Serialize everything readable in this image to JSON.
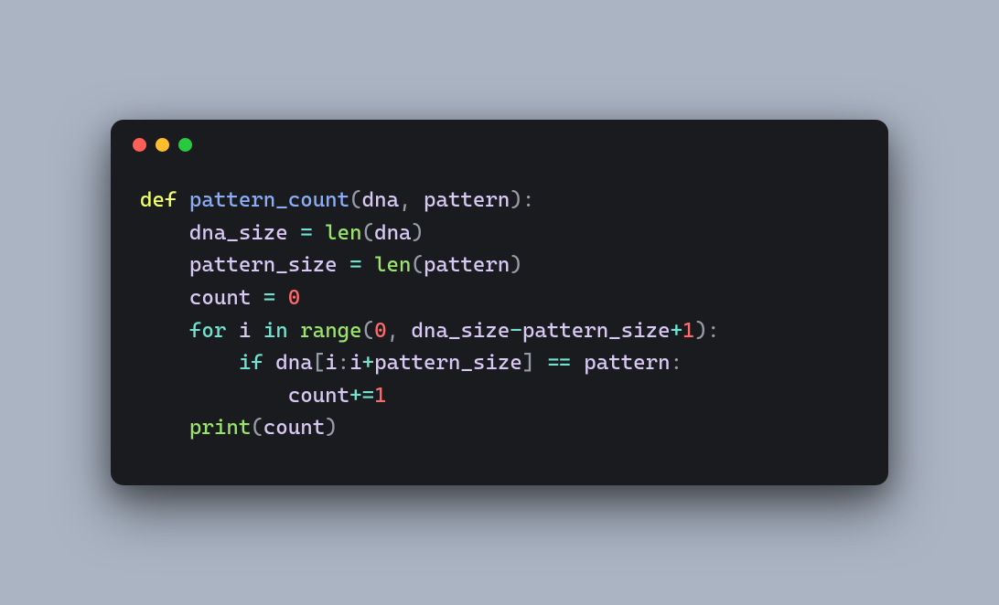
{
  "code": {
    "tokens": [
      [
        {
          "t": "def",
          "c": "kw-def"
        },
        {
          "t": " ",
          "c": ""
        },
        {
          "t": "pattern_count",
          "c": "fn-name"
        },
        {
          "t": "(",
          "c": "punct"
        },
        {
          "t": "dna",
          "c": "var"
        },
        {
          "t": ", ",
          "c": "punct"
        },
        {
          "t": "pattern",
          "c": "var"
        },
        {
          "t": "):",
          "c": "punct"
        }
      ],
      [
        {
          "t": "    ",
          "c": ""
        },
        {
          "t": "dna_size",
          "c": "var"
        },
        {
          "t": " ",
          "c": ""
        },
        {
          "t": "=",
          "c": "op"
        },
        {
          "t": " ",
          "c": ""
        },
        {
          "t": "len",
          "c": "builtin"
        },
        {
          "t": "(",
          "c": "punct"
        },
        {
          "t": "dna",
          "c": "var"
        },
        {
          "t": ")",
          "c": "punct"
        }
      ],
      [
        {
          "t": "    ",
          "c": ""
        },
        {
          "t": "pattern_size",
          "c": "var"
        },
        {
          "t": " ",
          "c": ""
        },
        {
          "t": "=",
          "c": "op"
        },
        {
          "t": " ",
          "c": ""
        },
        {
          "t": "len",
          "c": "builtin"
        },
        {
          "t": "(",
          "c": "punct"
        },
        {
          "t": "pattern",
          "c": "var"
        },
        {
          "t": ")",
          "c": "punct"
        }
      ],
      [
        {
          "t": "    ",
          "c": ""
        },
        {
          "t": "count",
          "c": "var"
        },
        {
          "t": " ",
          "c": ""
        },
        {
          "t": "=",
          "c": "op"
        },
        {
          "t": " ",
          "c": ""
        },
        {
          "t": "0",
          "c": "num"
        }
      ],
      [
        {
          "t": "    ",
          "c": ""
        },
        {
          "t": "for",
          "c": "kw-flow"
        },
        {
          "t": " ",
          "c": ""
        },
        {
          "t": "i",
          "c": "var"
        },
        {
          "t": " ",
          "c": ""
        },
        {
          "t": "in",
          "c": "kw-flow"
        },
        {
          "t": " ",
          "c": ""
        },
        {
          "t": "range",
          "c": "builtin"
        },
        {
          "t": "(",
          "c": "punct"
        },
        {
          "t": "0",
          "c": "num"
        },
        {
          "t": ", ",
          "c": "punct"
        },
        {
          "t": "dna_size",
          "c": "var"
        },
        {
          "t": "-",
          "c": "op"
        },
        {
          "t": "pattern_size",
          "c": "var"
        },
        {
          "t": "+",
          "c": "op"
        },
        {
          "t": "1",
          "c": "num"
        },
        {
          "t": "):",
          "c": "punct"
        }
      ],
      [
        {
          "t": "        ",
          "c": ""
        },
        {
          "t": "if",
          "c": "kw-flow"
        },
        {
          "t": " ",
          "c": ""
        },
        {
          "t": "dna",
          "c": "var"
        },
        {
          "t": "[",
          "c": "punct"
        },
        {
          "t": "i",
          "c": "var"
        },
        {
          "t": ":",
          "c": "punct"
        },
        {
          "t": "i",
          "c": "var"
        },
        {
          "t": "+",
          "c": "op"
        },
        {
          "t": "pattern_size",
          "c": "var"
        },
        {
          "t": "]",
          "c": "punct"
        },
        {
          "t": " ",
          "c": ""
        },
        {
          "t": "==",
          "c": "op"
        },
        {
          "t": " ",
          "c": ""
        },
        {
          "t": "pattern",
          "c": "var"
        },
        {
          "t": ":",
          "c": "punct"
        }
      ],
      [
        {
          "t": "            ",
          "c": ""
        },
        {
          "t": "count",
          "c": "var"
        },
        {
          "t": "+=",
          "c": "op"
        },
        {
          "t": "1",
          "c": "num"
        }
      ],
      [
        {
          "t": "    ",
          "c": ""
        },
        {
          "t": "print",
          "c": "builtin"
        },
        {
          "t": "(",
          "c": "punct"
        },
        {
          "t": "count",
          "c": "var"
        },
        {
          "t": ")",
          "c": "punct"
        }
      ]
    ]
  }
}
